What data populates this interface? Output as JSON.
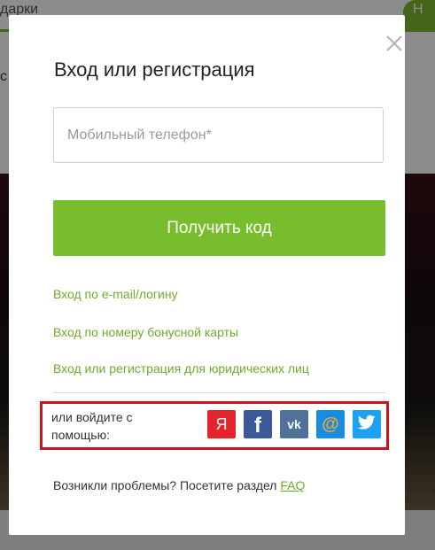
{
  "background": {
    "top_tab_text": "дарки",
    "right_tab_text": "Н",
    "side_text": "с"
  },
  "modal": {
    "title": "Вход или регистрация",
    "phone_placeholder": "Мобильный телефон*",
    "phone_value": "",
    "get_code_label": "Получить код",
    "links": {
      "email_login": "Вход по e-mail/логину",
      "bonus_card": "Вход по номеру бонусной карты",
      "legal_entities": "Вход или регистрация для юридических лиц"
    },
    "social": {
      "label_line1": "или войдите с",
      "label_line2": "помощью:",
      "buttons": [
        {
          "name": "yandex",
          "glyph": "Я",
          "color": "#e4232b"
        },
        {
          "name": "facebook",
          "glyph": "f",
          "color": "#3b5998"
        },
        {
          "name": "vk",
          "glyph": "vk",
          "color": "#507299"
        },
        {
          "name": "mailru",
          "glyph": "@",
          "color": "#168de2"
        },
        {
          "name": "twitter",
          "glyph": "twitter-bird",
          "color": "#1da1f2"
        }
      ]
    },
    "help_text": "Возникли проблемы? Посетите раздел ",
    "faq_label": "FAQ"
  },
  "colors": {
    "accent_green": "#78bd2c",
    "link_green": "#6fab2a",
    "highlight_red": "#d0121b"
  }
}
